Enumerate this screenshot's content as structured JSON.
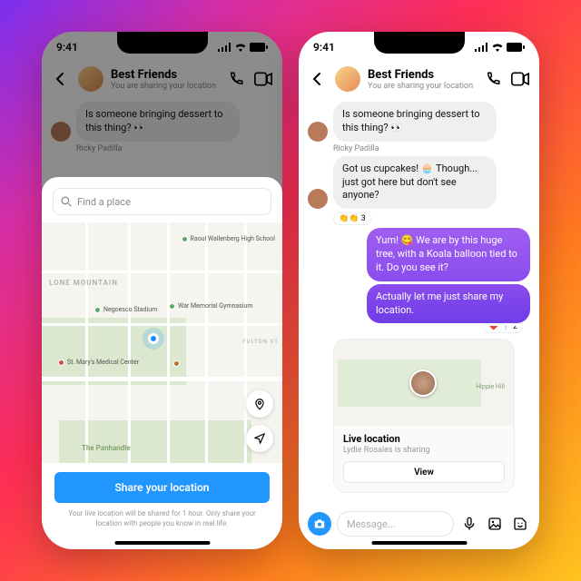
{
  "status": {
    "time": "9:41"
  },
  "header": {
    "title": "Best Friends",
    "subtitle": "You are sharing your location"
  },
  "thread": {
    "sender1": "Ricky Padilla",
    "msg1": "Is someone bringing dessert to this thing? 👀",
    "msg2": "Got us cupcakes! 🧁 Though... just got here but don't see anyone?",
    "react2": "👏👏 3",
    "msg3": "Yum! 😋 We are by this huge tree, with a Koala balloon tied to it. Do you see it?",
    "msg4": "Actually let me just share my location.",
    "react4": "❤️ 📍 2"
  },
  "sheet": {
    "search_placeholder": "Find a place",
    "hood_lone": "LONE MOUNTAIN",
    "hood_pan": "The Panhandle",
    "poi_raoul": "Raoul Wallenberg High School",
    "poi_negoesco": "Negoesco Stadium",
    "poi_war": "War Memorial Gymnasium",
    "poi_stmary": "St. Mary's Medical Center",
    "street_fulton": "FULTON ST",
    "share_btn": "Share your location",
    "footnote": "Your live location will be shared for 1 hour. Only share your location with people you know in real life."
  },
  "live": {
    "hill": "Hippie Hill",
    "title": "Live location",
    "subtitle": "Lydie Rosales is sharing",
    "view": "View"
  },
  "composer": {
    "placeholder": "Message..."
  }
}
